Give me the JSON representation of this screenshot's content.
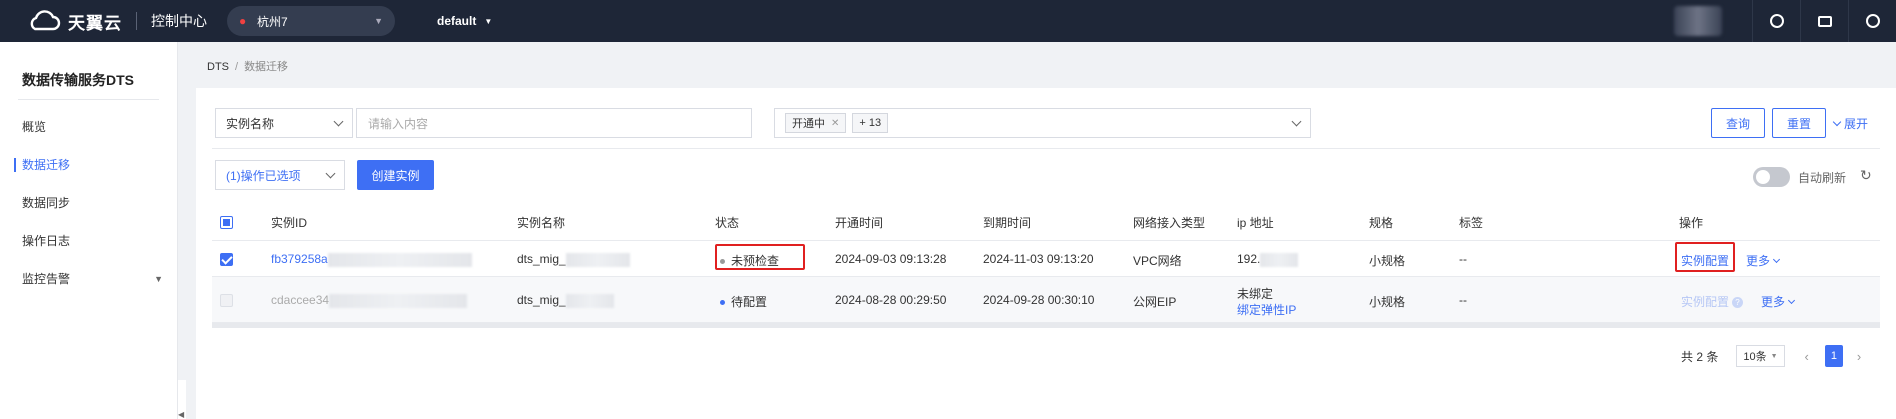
{
  "topbar": {
    "brand": "天翼云",
    "console": "控制中心",
    "region": "杭州7",
    "project": "default"
  },
  "sidebar": {
    "title": "数据传输服务DTS",
    "items": [
      {
        "label": "概览"
      },
      {
        "label": "数据迁移"
      },
      {
        "label": "数据同步"
      },
      {
        "label": "操作日志"
      },
      {
        "label": "监控告警"
      }
    ]
  },
  "breadcrumb": {
    "root": "DTS",
    "sep": "/",
    "current": "数据迁移"
  },
  "filters": {
    "field_select": "实例名称",
    "search_placeholder": "请输入内容",
    "status_tag": "开通中",
    "status_more": "+ 13",
    "query_btn": "查询",
    "reset_btn": "重置",
    "expand_link": "展开"
  },
  "toolbar": {
    "batch_select": "(1)操作已选项",
    "create_btn": "创建实例",
    "auto_refresh": "自动刷新"
  },
  "table": {
    "headers": [
      "实例ID",
      "实例名称",
      "状态",
      "开通时间",
      "到期时间",
      "网络接入类型",
      "ip 地址",
      "规格",
      "标签",
      "操作"
    ],
    "rows": [
      {
        "id": "fb379258a",
        "name": "dts_mig_",
        "status": "未预检查",
        "open_time": "2024-09-03 09:13:28",
        "expire_time": "2024-11-03 09:13:20",
        "network": "VPC网络",
        "ip": "192.",
        "spec": "小规格",
        "tag": "--",
        "action": "实例配置",
        "more": "更多"
      },
      {
        "id": "cdaccee34",
        "name": "dts_mig_",
        "status": "待配置",
        "open_time": "2024-08-28 00:29:50",
        "expire_time": "2024-09-28 00:30:10",
        "network": "公网EIP",
        "ip_line1": "未绑定",
        "ip_line2": "绑定弹性IP",
        "spec": "小规格",
        "tag": "--",
        "action": "实例配置",
        "more": "更多"
      }
    ]
  },
  "pagination": {
    "total": "共 2 条",
    "page_size": "10条",
    "current": "1"
  },
  "colors": {
    "accent": "#3e6ff4",
    "topbar": "#1e2637",
    "highlight": "#e02020"
  }
}
